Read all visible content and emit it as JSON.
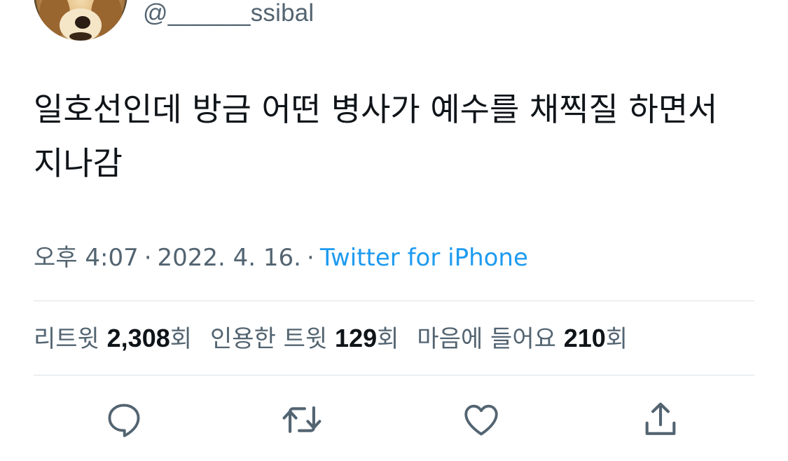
{
  "author": {
    "handle": "@______ssibal"
  },
  "tweet": {
    "text": "일호선인데 방금 어떤 병사가 예수를 채찍질 하면서 지나감"
  },
  "meta": {
    "time": "오후 4:07",
    "separator": "·",
    "date": "2022. 4. 16.",
    "source": "Twitter for iPhone"
  },
  "stats": {
    "retweets": {
      "label": "리트윗 ",
      "count": "2,308",
      "suffix": "회"
    },
    "quotes": {
      "label": "인용한 트윗 ",
      "count": "129",
      "suffix": "회"
    },
    "likes": {
      "label": "마음에 들어요 ",
      "count": "210",
      "suffix": "회"
    }
  },
  "actions": {
    "icons": [
      "reply-icon",
      "retweet-icon",
      "like-icon",
      "share-icon"
    ]
  },
  "colors": {
    "text": "#0f1419",
    "secondary": "#536471",
    "link": "#1d9bf0",
    "divider": "#dde2e6"
  }
}
